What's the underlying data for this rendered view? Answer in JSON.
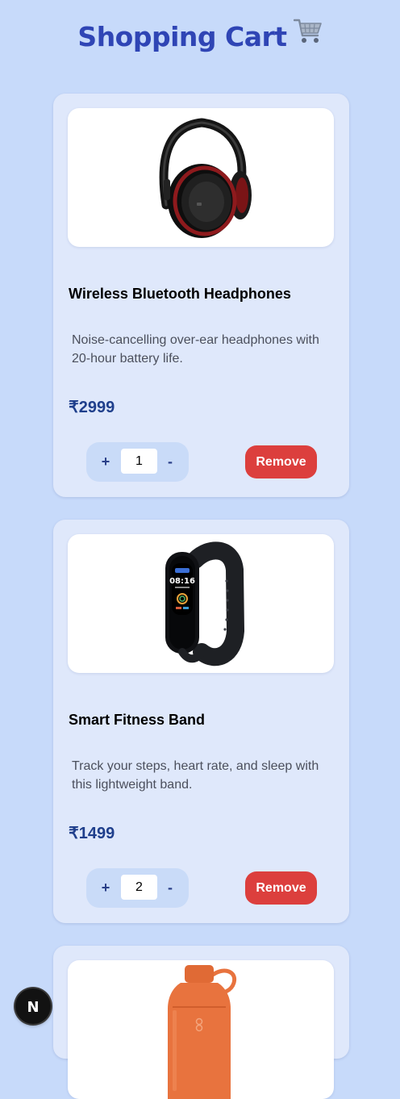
{
  "header": {
    "title": "Shopping Cart",
    "icon": "shopping-cart-icon"
  },
  "cart": {
    "items": [
      {
        "name": "Wireless Bluetooth Headphones",
        "description": "Noise-cancelling over-ear headphones with 20-hour battery life.",
        "price": "₹2999",
        "quantity": "1",
        "increment_label": "+",
        "decrement_label": "-",
        "remove_label": "Remove",
        "image": "headphones-image"
      },
      {
        "name": "Smart Fitness Band",
        "description": "Track your steps, heart rate, and sleep with this lightweight band.",
        "price": "₹1499",
        "quantity": "2",
        "increment_label": "+",
        "decrement_label": "-",
        "remove_label": "Remove",
        "image": "fitness-band-image",
        "screen_time": "08:16"
      },
      {
        "image": "water-bottle-image"
      }
    ]
  },
  "dev_badge": {
    "letter": "N",
    "icon": "nextjs-icon"
  },
  "colors": {
    "background": "#c7dafa",
    "card": "#dfe8fb",
    "title": "#2f45b5",
    "price": "#1f3f8c",
    "remove": "#dc3f3d",
    "quantity_group": "#c9dbf8"
  }
}
